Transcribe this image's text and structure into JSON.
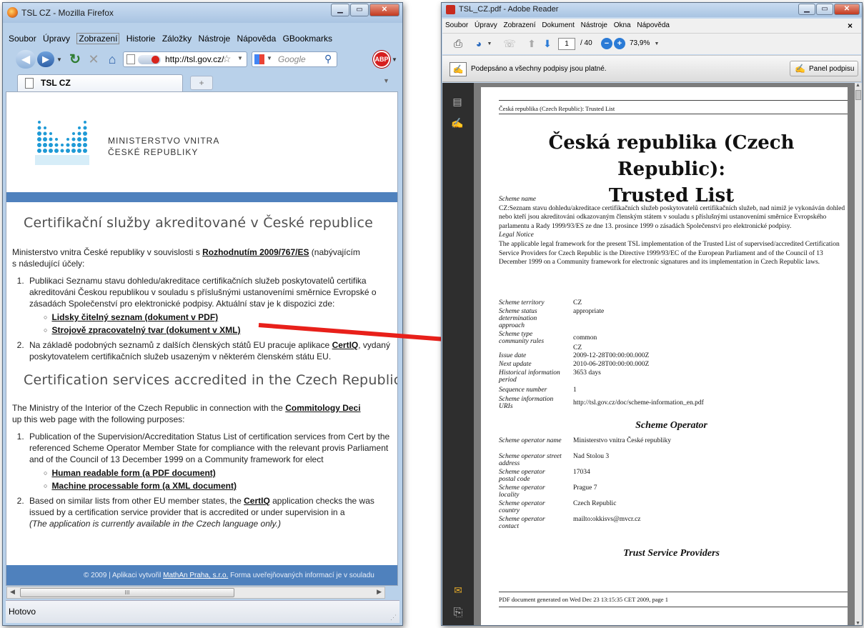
{
  "firefox": {
    "title": "TSL CZ - Mozilla Firefox",
    "menu": [
      "Soubor",
      "Úpravy",
      "Zobrazení",
      "Historie",
      "Záložky",
      "Nástroje",
      "Nápověda",
      "GBookmarks"
    ],
    "url": "http://tsl.gov.cz/",
    "search_placeholder": "Google",
    "tab_label": "TSL CZ",
    "new_tab_label": "+",
    "logo_line1": "MINISTERSTVO VNITRA",
    "logo_line2": "ČESKÉ REPUBLIKY",
    "cz_heading": "Certifikační služby akreditované v České republice",
    "cz_intro_1": "Ministerstvo vnitra České republiky v souvislosti s ",
    "cz_intro_link": "Rozhodnutím 2009/767/ES",
    "cz_intro_2": " (nabývajícím",
    "cz_intro_3": "s následující účely:",
    "cz_item1": "Publikaci Seznamu stavu dohledu/akreditace certifikačních služeb poskytovatelů certifika akreditováni Českou republikou v souladu s příslušnými ustanoveními směrnice Evropské o zásadách Společenství pro elektronické podpisy. Aktuální stav je k dispozici zde:",
    "cz_sub1": "Lidsky čitelný seznam (dokument v PDF)",
    "cz_sub2": "Strojově zpracovatelný tvar (dokument v XML)",
    "cz_item2_1": "Na základě podobných seznamů z dalších členských států EU pracuje aplikace ",
    "cz_item2_link": "CertIQ",
    "cz_item2_2": ", vydaný poskytovatelem certifikačních služeb usazeným v některém členském státu EU.",
    "en_heading": "Certification services accredited in the Czech Republic",
    "en_intro_1": "The Ministry of the Interior of the Czech Republic in connection with the ",
    "en_intro_link": "Commitology Deci",
    "en_intro_2": "up this web page with the following purposes:",
    "en_item1": "Publication of the Supervision/Accreditation Status List of certification services from Cert by the referenced Scheme Operator Member State for compliance with the relevant provis Parliament and of the Council of 13 December 1999 on a Community framework for elect",
    "en_sub1": "Human readable form (a PDF document)",
    "en_sub2": "Machine processable form (a XML document)",
    "en_item2_1": "Based on similar lists from other EU member states, the ",
    "en_item2_link": "CertIQ",
    "en_item2_2": " application checks the was issued by a certification service provider that is accredited or under supervision in a",
    "en_item2_note": "(The application is currently available in the Czech language only.)",
    "footer_1": "© 2009 | Aplikaci vytvořil ",
    "footer_link": "MathAn Praha, s.r.o.",
    "footer_2": " Forma uveřejňovaných informací je v souladu",
    "status": "Hotovo",
    "scroll_mid": "III"
  },
  "reader": {
    "title": "TSL_CZ.pdf - Adobe Reader",
    "menu": [
      "Soubor",
      "Úpravy",
      "Zobrazení",
      "Dokument",
      "Nástroje",
      "Okna",
      "Nápověda"
    ],
    "page_current": "1",
    "page_total": "/ 40",
    "zoom": "73,9%",
    "signature_msg": "Podepsáno a všechny podpisy jsou platné.",
    "signature_panel": "Panel podpisu",
    "close_doc": "×"
  },
  "pdf": {
    "header": "Česká republika (Czech Republic): Trusted List",
    "title_line1": "Česká republika (Czech Republic):",
    "title_line2": "Trusted List",
    "scheme_name_label": "Scheme name",
    "scheme_name": "CZ:Seznam stavu dohledu/akreditace certifikačních služeb poskytovatelů certifikačních služeb, nad nimiž je vykonáván dohled nebo kteří jsou akreditováni odkazovaným členským státem v souladu s příslušnými ustanoveními směrnice Evropského parlamentu a Rady 1999/93/ES ze dne 13. prosince 1999 o zásadách Společenství pro elektronické podpisy.",
    "legal_notice_label": "Legal Notice",
    "legal_notice": "The applicable legal framework for the present TSL implementation of the Trusted List of supervised/accredited Certification Service Providers for Czech Republic is the Directive 1999/93/EC of the European Parliament and of the Council of 13 December 1999 on a Community framework for electronic signatures and its implementation in Czech Republic laws.",
    "fields": [
      {
        "k": "Scheme territory",
        "v": "CZ"
      },
      {
        "k": "Scheme status determination approach",
        "v": "appropriate"
      },
      {
        "k": "Scheme type community rules",
        "v": "common"
      },
      {
        "k": "",
        "v": "CZ"
      },
      {
        "k": "Issue date",
        "v": "2009-12-28T00:00:00.000Z"
      },
      {
        "k": "Next update",
        "v": "2010-06-28T00:00:00.000Z"
      },
      {
        "k": "Historical information period",
        "v": "3653 days"
      },
      {
        "k": "Sequence number",
        "v": "1"
      },
      {
        "k": "Scheme information URIs",
        "v": "http://tsl.gov.cz/doc/scheme-information_en.pdf"
      }
    ],
    "operator_heading": "Scheme Operator",
    "operator_fields": [
      {
        "k": "Scheme operator name",
        "v": "Ministerstvo vnitra České republiky"
      },
      {
        "k": "Scheme operator street address",
        "v": "Nad Stolou 3"
      },
      {
        "k": "Scheme operator postal code",
        "v": "17034"
      },
      {
        "k": "Scheme operator locality",
        "v": "Prague 7"
      },
      {
        "k": "Scheme operator country",
        "v": "Czech Republic"
      },
      {
        "k": "Scheme operator contact",
        "v": "mailto:okkisvs@mvcr.cz"
      }
    ],
    "tsp_heading": "Trust Service Providers",
    "footer": "PDF document generated on Wed Dec 23 13:15:35 CET 2009, page 1"
  },
  "colors": {
    "arrow": "#e8201a",
    "banner_blue": "#4f81bd",
    "logo_blue": "#1e9ad6"
  }
}
